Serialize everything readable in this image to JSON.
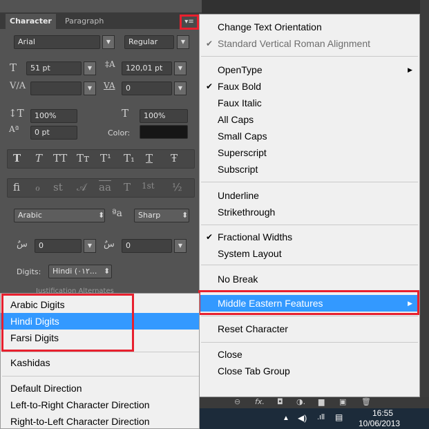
{
  "panel": {
    "tabs": [
      "Character",
      "Paragraph"
    ],
    "font_family": "Arial",
    "font_style": "Regular",
    "font_size": "51 pt",
    "leading": "120,01 pt",
    "tracking": "0",
    "vertical_scale": "100%",
    "horizontal_scale": "100%",
    "baseline_shift": "0 pt",
    "color_label": "Color:",
    "typestyle_glyphs": [
      "T",
      "T",
      "TT",
      "Tт",
      "T¹",
      "T₁",
      "T",
      "Ŧ"
    ],
    "opentype_glyphs": [
      "fi",
      "ℴ",
      "st",
      "𝒜",
      "aa",
      "T",
      "1st",
      "½"
    ],
    "language": "Arabic",
    "aa_glyph": "ªa",
    "antialias": "Sharp",
    "arabic_field1": "0",
    "arabic_field2": "0",
    "digits_label": "Digits:",
    "digits_value": "Hindi (٠١٢...",
    "justification_label": "Justification Alternates"
  },
  "menu": {
    "items": [
      {
        "label": "Change Text Orientation",
        "checked": false,
        "disabled": false,
        "submenu": false
      },
      {
        "label": "Standard Vertical Roman Alignment",
        "checked": true,
        "disabled": true,
        "submenu": false
      },
      {
        "label": "OpenType",
        "checked": false,
        "disabled": false,
        "submenu": true
      },
      {
        "label": "Faux Bold",
        "checked": true,
        "disabled": false,
        "submenu": false
      },
      {
        "label": "Faux Italic",
        "checked": false,
        "disabled": false,
        "submenu": false
      },
      {
        "label": "All Caps",
        "checked": false,
        "disabled": false,
        "submenu": false
      },
      {
        "label": "Small Caps",
        "checked": false,
        "disabled": false,
        "submenu": false
      },
      {
        "label": "Superscript",
        "checked": false,
        "disabled": false,
        "submenu": false
      },
      {
        "label": "Subscript",
        "checked": false,
        "disabled": false,
        "submenu": false
      },
      {
        "label": "Underline",
        "checked": false,
        "disabled": false,
        "submenu": false
      },
      {
        "label": "Strikethrough",
        "checked": false,
        "disabled": false,
        "submenu": false
      },
      {
        "label": "Fractional Widths",
        "checked": true,
        "disabled": false,
        "submenu": false
      },
      {
        "label": "System Layout",
        "checked": false,
        "disabled": false,
        "submenu": false
      },
      {
        "label": "No Break",
        "checked": false,
        "disabled": false,
        "submenu": false
      },
      {
        "label": "Middle Eastern Features",
        "checked": false,
        "disabled": false,
        "submenu": true,
        "highlighted": true
      },
      {
        "label": "Reset Character",
        "checked": false,
        "disabled": false,
        "submenu": false
      },
      {
        "label": "Close",
        "checked": false,
        "disabled": false,
        "submenu": false
      },
      {
        "label": "Close Tab Group",
        "checked": false,
        "disabled": false,
        "submenu": false
      }
    ],
    "check_glyph": "✔",
    "arrow_glyph": "▶"
  },
  "submenu": {
    "items": [
      {
        "label": "Arabic Digits",
        "selected": false
      },
      {
        "label": "Hindi Digits",
        "selected": true
      },
      {
        "label": "Farsi Digits",
        "selected": false
      },
      {
        "label": "Kashidas",
        "selected": false
      },
      {
        "label": "Default Direction",
        "selected": false
      },
      {
        "label": "Left-to-Right Character Direction",
        "selected": false
      },
      {
        "label": "Right-to-Left Character Direction",
        "selected": false
      }
    ]
  },
  "taskbar": {
    "time": "16:55",
    "date": "10/06/2013"
  },
  "colors": {
    "highlight": "#3399ff",
    "callout": "#e8202e"
  }
}
